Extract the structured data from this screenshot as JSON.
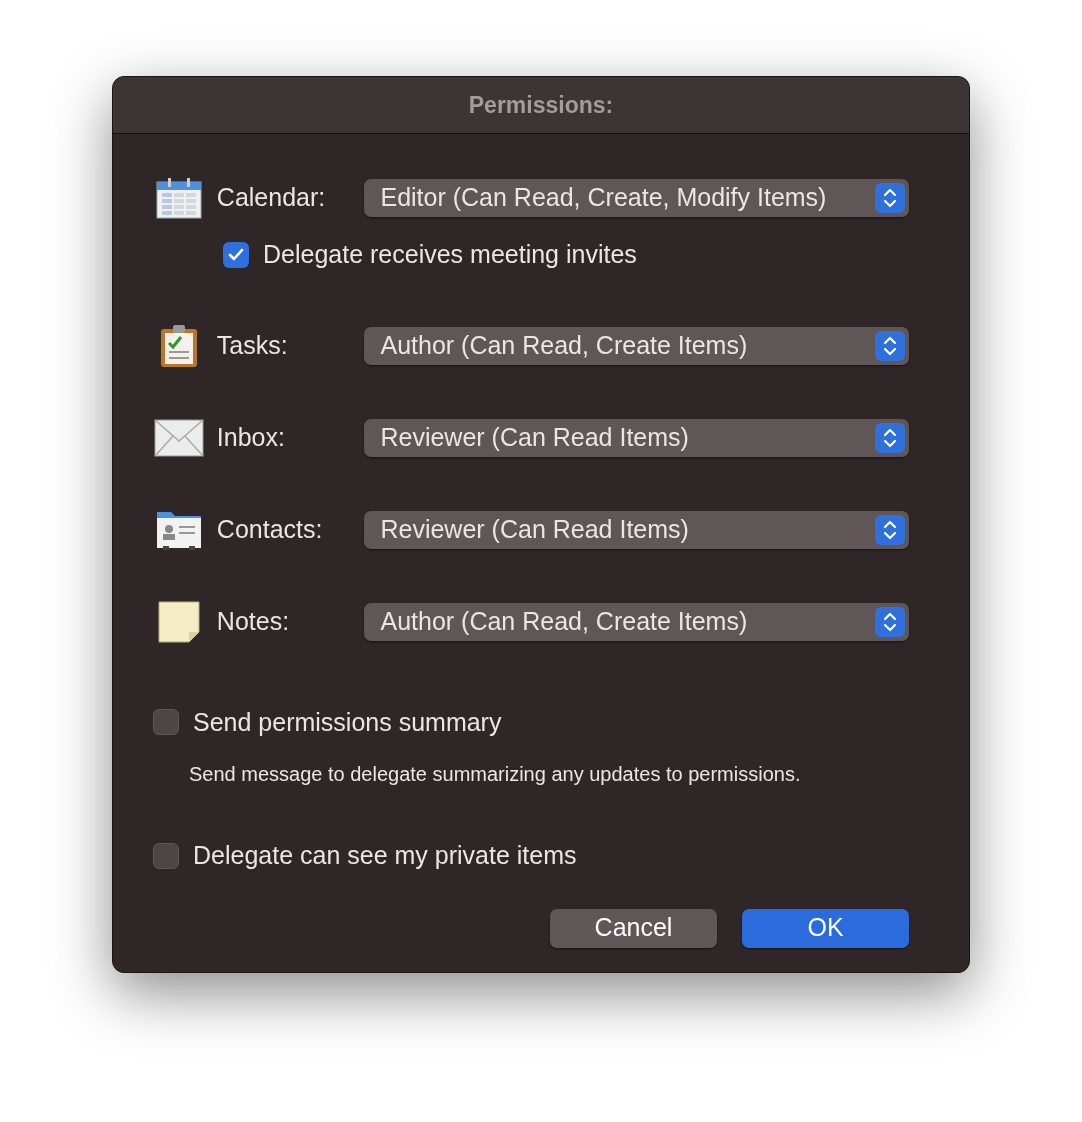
{
  "window": {
    "title": "Permissions:"
  },
  "folders": [
    {
      "kind": "calendar",
      "label": "Calendar:",
      "value": "Editor (Can Read, Create, Modify Items)",
      "option": {
        "label": "Delegate receives meeting invites",
        "checked": true
      }
    },
    {
      "kind": "tasks",
      "label": "Tasks:",
      "value": "Author (Can Read, Create Items)"
    },
    {
      "kind": "inbox",
      "label": "Inbox:",
      "value": "Reviewer (Can Read Items)"
    },
    {
      "kind": "contacts",
      "label": "Contacts:",
      "value": "Reviewer (Can Read Items)"
    },
    {
      "kind": "notes",
      "label": "Notes:",
      "value": "Author (Can Read, Create Items)"
    }
  ],
  "options": [
    {
      "label": "Send permissions summary",
      "checked": false,
      "description": "Send message to delegate summarizing any updates to permissions."
    },
    {
      "label": "Delegate can see my private items",
      "checked": false
    }
  ],
  "buttons": [
    {
      "label": "Cancel",
      "kind": "secondary"
    },
    {
      "label": "OK",
      "kind": "primary"
    }
  ]
}
